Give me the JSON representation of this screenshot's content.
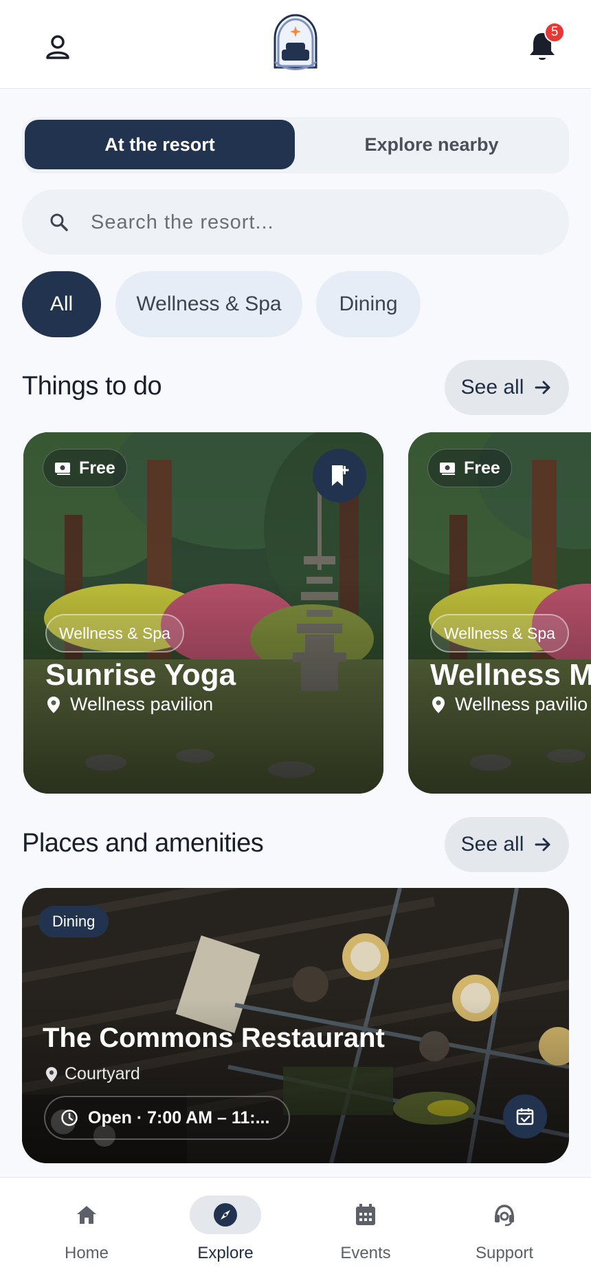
{
  "header": {
    "profile_icon": "person-icon",
    "logo_icon": "resort-bed-logo",
    "bell_icon": "bell-icon",
    "notification_count": "5"
  },
  "segmented": {
    "active": "At the resort",
    "inactive": "Explore nearby"
  },
  "search": {
    "placeholder": "Search the resort..."
  },
  "filters": [
    "All",
    "Wellness & Spa",
    "Dining"
  ],
  "things_to_do": {
    "title": "Things to do",
    "see_all": "See all",
    "cards": [
      {
        "price": "Free",
        "category": "Wellness & Spa",
        "title": "Sunrise Yoga",
        "location": "Wellness pavilion"
      },
      {
        "price": "Free",
        "category": "Wellness & Spa",
        "title": "Wellness Ma",
        "location": "Wellness pavilio"
      }
    ]
  },
  "places": {
    "title": "Places and amenities",
    "see_all": "See all",
    "card": {
      "tag": "Dining",
      "title": "The Commons Restaurant",
      "location": "Courtyard",
      "hours": "Open · 7:00 AM – 11:..."
    }
  },
  "nav": {
    "items": [
      "Home",
      "Explore",
      "Events",
      "Support"
    ],
    "active": "Explore"
  },
  "colors": {
    "primary": "#223350",
    "background": "#f7f9fc",
    "badge": "#e53935"
  }
}
